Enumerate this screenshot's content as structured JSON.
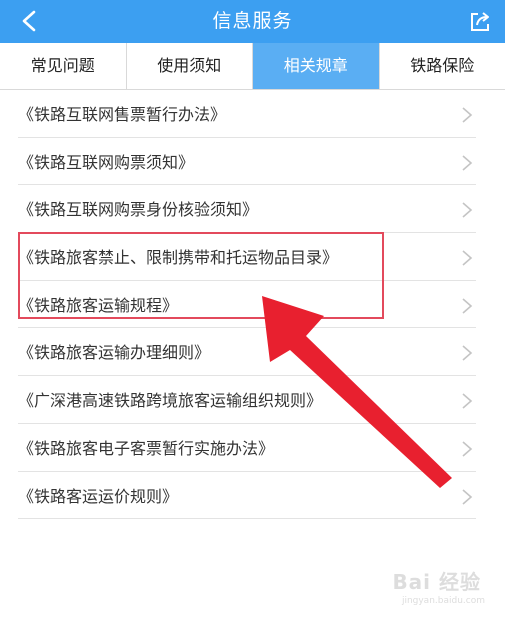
{
  "header": {
    "title": "信息服务",
    "back_icon": "chevron-left-icon",
    "share_icon": "share-icon",
    "bg_color": "#3c9ff1"
  },
  "tabs": [
    {
      "label": "常见问题",
      "active": false
    },
    {
      "label": "使用须知",
      "active": false
    },
    {
      "label": "相关规章",
      "active": true
    },
    {
      "label": "铁路保险",
      "active": false
    }
  ],
  "list": [
    {
      "label": "《铁路互联网售票暂行办法》"
    },
    {
      "label": "《铁路互联网购票须知》"
    },
    {
      "label": "《铁路互联网购票身份核验须知》"
    },
    {
      "label": "《铁路旅客禁止、限制携带和托运物品目录》"
    },
    {
      "label": "《铁路旅客运输规程》"
    },
    {
      "label": "《铁路旅客运输办理细则》"
    },
    {
      "label": "《广深港高速铁路跨境旅客运输组织规则》"
    },
    {
      "label": "《铁路旅客电子客票暂行实施办法》"
    },
    {
      "label": "《铁路客运运价规则》"
    }
  ],
  "watermark": {
    "text": "Bai 经验",
    "sub": "jingyan.baidu.com"
  },
  "colors": {
    "accent": "#3c9ff1",
    "active_tab": "#5aaef3",
    "highlight": "#e34a5c",
    "arrow": "#e8202f"
  }
}
